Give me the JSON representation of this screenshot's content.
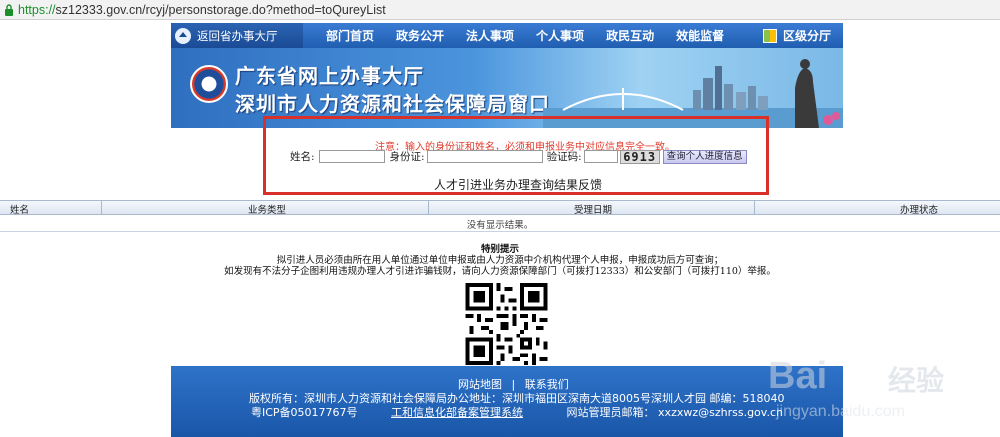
{
  "browser": {
    "url_scheme": "https://",
    "url_rest": "sz12333.gov.cn/rcyj/personstorage.do?method=toQureyList"
  },
  "nav": {
    "home": "返回省办事大厅",
    "items": [
      "部门首页",
      "政务公开",
      "法人事项",
      "个人事项",
      "政民互动",
      "效能监督"
    ],
    "district": "区级分厅"
  },
  "banner": {
    "line1": "广东省网上办事大厅",
    "line2": "深圳市人力资源和社会保障局窗口"
  },
  "form": {
    "notice": "注意：输入的身份证和姓名，必须和申报业务中对应信息完全一致。",
    "name_label": "姓名:",
    "id_label": "身份证:",
    "captcha_label": "验证码:",
    "captcha_code": "6913",
    "query_button": "查询个人进度信息"
  },
  "result_title": "人才引进业务办理查询结果反馈",
  "table": {
    "headers": [
      "姓名",
      "业务类型",
      "受理日期",
      "办理状态"
    ],
    "empty_text": "没有显示结果。"
  },
  "tips": {
    "title": "特别提示",
    "line1": "拟引进人员必须由所在用人单位通过单位申报或由人力资源中介机构代理个人申报，申报成功后方可查询；",
    "line2": "如发现有不法分子企图利用违规办理人才引进诈骗钱财，请向人力资源保障部门（可拨打12333）和公安部门（可拨打110）举报。"
  },
  "footer": {
    "sitemap": "网站地图",
    "separator": "|",
    "contact": "联系我们",
    "copyright": "版权所有：深圳市人力资源和社会保障局办公地址：深圳市福田区深南大道8005号深圳人才园 邮编：518040",
    "icp": "粤ICP备05017767号",
    "miit": "工和信息化部备案管理系统",
    "admin_label": "网站管理员邮箱：",
    "admin_email": "xxzxwz@szhrss.gov.cn"
  },
  "watermark": {
    "brand": "Bai",
    "brand_cn": "经验",
    "domain": "jingyan.baidu.com"
  },
  "colors": {
    "nav_blue": "#1f5eaf",
    "notice_red": "#e23b2e",
    "highlight_red": "#d9302a",
    "https_green": "#1a8f2a"
  }
}
